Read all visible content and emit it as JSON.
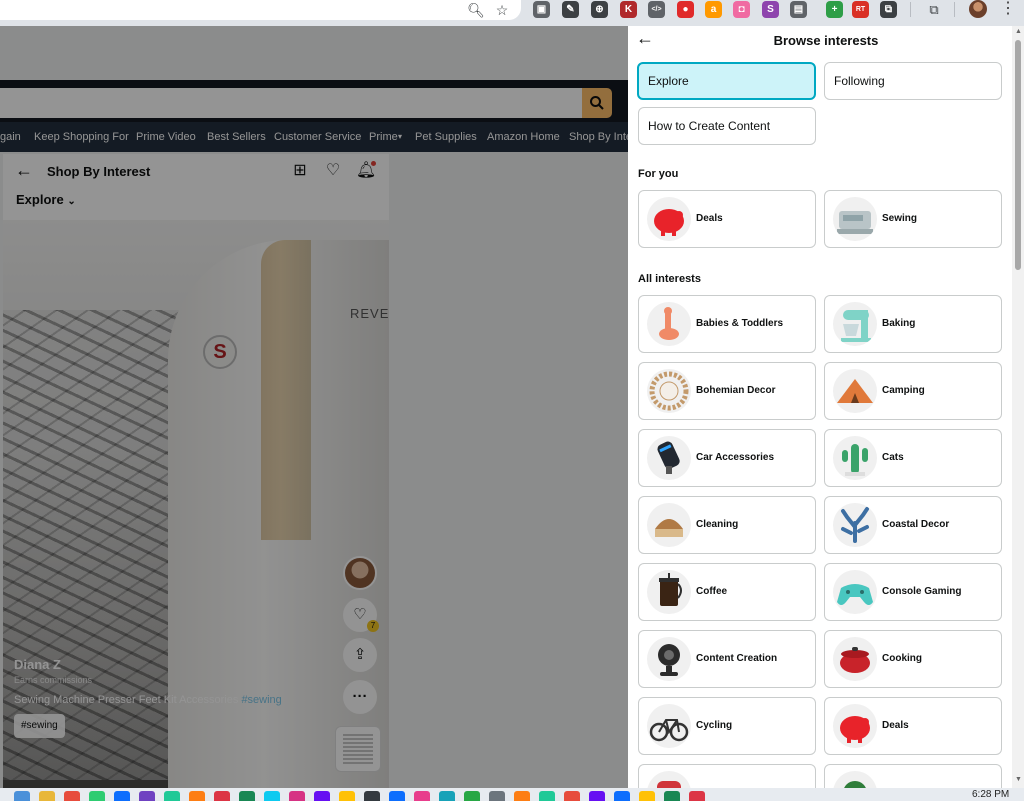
{
  "browser": {
    "omnibox_icons": [
      "zoom-icon",
      "star-icon"
    ],
    "extensions": [
      {
        "name": "reader-extension-icon",
        "glyph": "▣",
        "color": "#5f6368"
      },
      {
        "name": "eyedropper-extension-icon",
        "glyph": "✎",
        "color": "#3c4043"
      },
      {
        "name": "globe-extension-icon",
        "glyph": "⊕",
        "color": "#3c4043"
      },
      {
        "name": "dark-k-extension-icon",
        "glyph": "K",
        "color": "#b0292b"
      },
      {
        "name": "code-extension-icon",
        "glyph": "</>",
        "color": "#5f6368"
      },
      {
        "name": "red-circle-extension-icon",
        "glyph": "●",
        "color": "#e02a2a"
      },
      {
        "name": "amazon-a-extension-icon",
        "glyph": "a",
        "color": "#ff9900"
      },
      {
        "name": "pink-square-extension-icon",
        "glyph": "◘",
        "color": "#f06ba2"
      },
      {
        "name": "swirl-extension-icon",
        "glyph": "S",
        "color": "#8e44ad"
      },
      {
        "name": "notes-extension-icon",
        "glyph": "▤",
        "color": "#5f6368"
      },
      {
        "name": "plus-extension-icon",
        "glyph": "+",
        "color": "#2e9e47"
      },
      {
        "name": "rt-extension-icon",
        "glyph": "RT",
        "color": "#d93025"
      },
      {
        "name": "puzzle-extension-icon",
        "glyph": "⧉",
        "color": "#3c4043"
      }
    ],
    "side_search_icon": "side-panel-search-icon"
  },
  "amazon": {
    "nav_links": [
      "gain",
      "Keep Shopping For",
      "Prime Video",
      "Best Sellers",
      "Customer Service",
      "Prime",
      "Pet Supplies",
      "Amazon Home",
      "Shop By Inte"
    ]
  },
  "shop_by_interest": {
    "title": "Shop By Interest",
    "filter": "Explore",
    "post": {
      "creator_name": "Diana Z",
      "creator_sub": "Earns commissions",
      "caption": "Sewing Machine Presser Feet Kit Accessories",
      "caption_tag": "#sewing",
      "chip": "#sewing",
      "like_count": "7",
      "brand_text": "REVE",
      "logo_letter": "S"
    }
  },
  "panel": {
    "title": "Browse interests",
    "tabs": [
      {
        "label": "Explore",
        "active": true
      },
      {
        "label": "Following",
        "active": false
      },
      {
        "label": "How to Create Content",
        "active": false
      }
    ],
    "for_you_heading": "For you",
    "for_you": [
      {
        "label": "Deals",
        "icon": "piggy-bank-icon",
        "color": "#e8232a"
      },
      {
        "label": "Sewing",
        "icon": "sewing-machine-icon",
        "color": "#b9c4c7"
      }
    ],
    "all_heading": "All interests",
    "interests": [
      {
        "label": "Babies & Toddlers",
        "icon": "giraffe-toy-icon",
        "color": "#f08a67"
      },
      {
        "label": "Baking",
        "icon": "stand-mixer-icon",
        "color": "#7fd3c7"
      },
      {
        "label": "Bohemian Decor",
        "icon": "rattan-mirror-icon",
        "color": "#c39a6b"
      },
      {
        "label": "Camping",
        "icon": "tent-icon",
        "color": "#e0793a"
      },
      {
        "label": "Car Accessories",
        "icon": "car-charger-icon",
        "color": "#222831"
      },
      {
        "label": "Cats",
        "icon": "cactus-cat-tree-icon",
        "color": "#3aa36a"
      },
      {
        "label": "Cleaning",
        "icon": "brush-icon",
        "color": "#b07a45"
      },
      {
        "label": "Coastal Decor",
        "icon": "coral-icon",
        "color": "#3d6fa3"
      },
      {
        "label": "Coffee",
        "icon": "french-press-icon",
        "color": "#2f2f2f"
      },
      {
        "label": "Console Gaming",
        "icon": "game-controller-icon",
        "color": "#49c7c0"
      },
      {
        "label": "Content Creation",
        "icon": "webcam-icon",
        "color": "#2b2b2b"
      },
      {
        "label": "Cooking",
        "icon": "dutch-oven-icon",
        "color": "#c8232a"
      },
      {
        "label": "Cycling",
        "icon": "bicycle-icon",
        "color": "#333333"
      },
      {
        "label": "Deals",
        "icon": "piggy-bank-icon",
        "color": "#e8232a"
      },
      {
        "label": "",
        "icon": "red-product-icon",
        "color": "#d0343a"
      },
      {
        "label": "",
        "icon": "green-product-icon",
        "color": "#2f7d3a"
      }
    ]
  },
  "taskbar": {
    "time": "6:28 PM",
    "icons": [
      "#4a90d9",
      "#e8b73a",
      "#e74c3c",
      "#2ecc71",
      "#0d6efd",
      "#6f42c1",
      "#20c997",
      "#fd7e14",
      "#dc3545",
      "#198754",
      "#0dcaf0",
      "#d63384",
      "#6610f2",
      "#ffc107",
      "#343a40",
      "#0d6efd",
      "#e83e8c",
      "#17a2b8",
      "#28a745",
      "#6c757d",
      "#fd7e14",
      "#20c997",
      "#e74c3c",
      "#6610f2",
      "#0d6efd",
      "#ffc107",
      "#198754",
      "#dc3545"
    ]
  }
}
